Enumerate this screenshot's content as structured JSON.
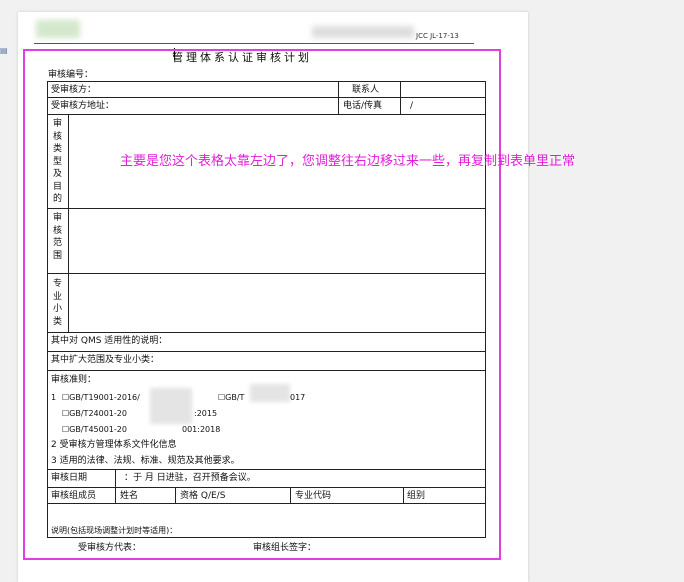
{
  "header": {
    "doc_code": "JCC JL-17-13"
  },
  "title": "管理体系认证审核计划",
  "audit_no_label": "审核编号：",
  "annotation": "主要是您这个表格太靠左边了，您调整往右边移过来一些，再复制到表单里正常",
  "form": {
    "auditee_label": "受审核方：",
    "contact_label": "联系人",
    "address_label": "受审核方地址：",
    "phone_fax_label": "电话/传真",
    "phone_fax_value": "/",
    "audit_type_label": "审核类型及目的",
    "audit_scope_label": "审核范围",
    "specialty_label": "专业小类",
    "qms_note_label": "其中对 QMS 适用性的说明：",
    "expand_scope_label": "其中扩大范围及专业小类：",
    "criteria_label": "审核准则：",
    "criteria_1_prefix": "1",
    "criteria_std_a": "☐GB/T19001-2016/",
    "criteria_std_b": "☐GB/T",
    "criteria_std_b_end": "017",
    "criteria_std_c": "☐GB/T24001-20",
    "criteria_std_c_end": ":2015",
    "criteria_std_d": "☐GB/T45001-20",
    "criteria_std_d_end": "001:2018",
    "criteria_2": "2 受审核方管理体系文件化信息",
    "criteria_3": "3 适用的法律、法规、标准、规范及其他要求。",
    "audit_date_label": "审核日期",
    "audit_date_value": "：于  月  日进驻，召开预备会议。",
    "members_label": "审核组成员",
    "col_name": "姓名",
    "col_qual": "资格 Q/E/S",
    "col_code": "专业代码",
    "col_group": "组别",
    "remark_label": "说明(包括现场调整计划时等适用)：",
    "auditee_rep_label": "受审核方代表：",
    "leader_sign_label": "审核组长签字："
  }
}
